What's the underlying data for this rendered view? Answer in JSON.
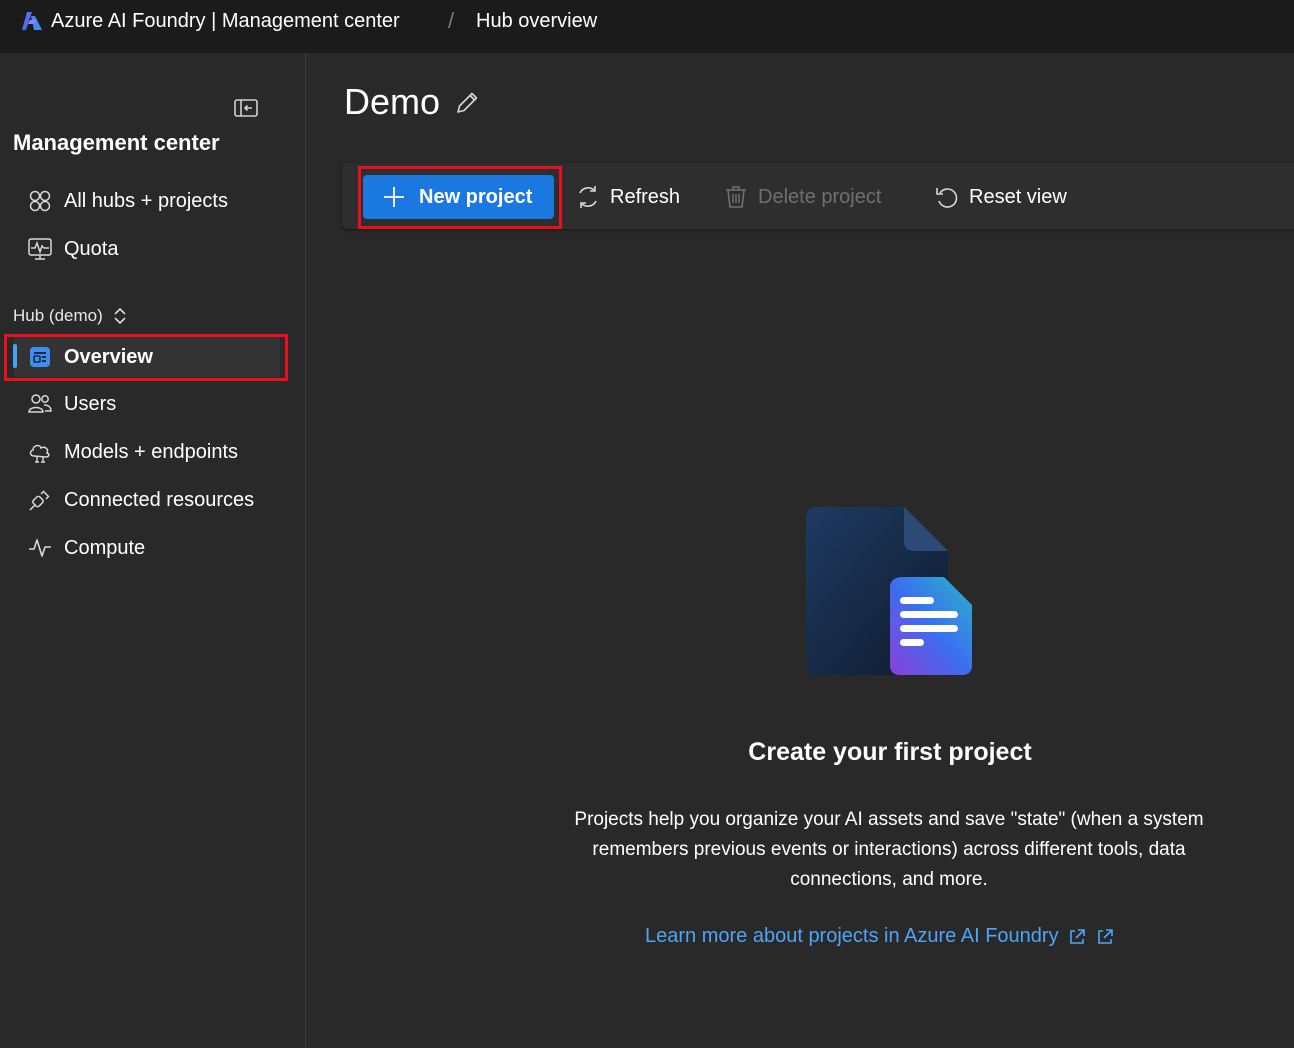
{
  "topbar": {
    "app_title": "Azure AI Foundry | Management center",
    "separator": "/",
    "page_crumb": "Hub overview"
  },
  "sidebar": {
    "title": "Management center",
    "global_items": [
      {
        "label": "All hubs + projects",
        "icon": "grid-icon"
      },
      {
        "label": "Quota",
        "icon": "quota-icon"
      }
    ],
    "hub_label": "Hub (demo)",
    "hub_items": [
      {
        "label": "Overview",
        "icon": "overview-icon",
        "active": true
      },
      {
        "label": "Users",
        "icon": "users-icon"
      },
      {
        "label": "Models + endpoints",
        "icon": "cloud-icon"
      },
      {
        "label": "Connected resources",
        "icon": "plug-icon"
      },
      {
        "label": "Compute",
        "icon": "pulse-icon"
      }
    ]
  },
  "main": {
    "title": "Demo",
    "toolbar": {
      "new_project": "New project",
      "refresh": "Refresh",
      "delete_project": "Delete project",
      "reset_view": "Reset view"
    },
    "empty_state": {
      "title": "Create your first project",
      "description": "Projects help you organize your AI assets and save \"state\" (when a system remembers previous events or interactions) across different tools, data connections, and more.",
      "link": "Learn more about projects in Azure AI Foundry"
    }
  },
  "colors": {
    "accent": "#1a78e0",
    "link": "#4ea4f7",
    "highlight": "#e8101d",
    "active_indicator": "#4aa0f5"
  }
}
